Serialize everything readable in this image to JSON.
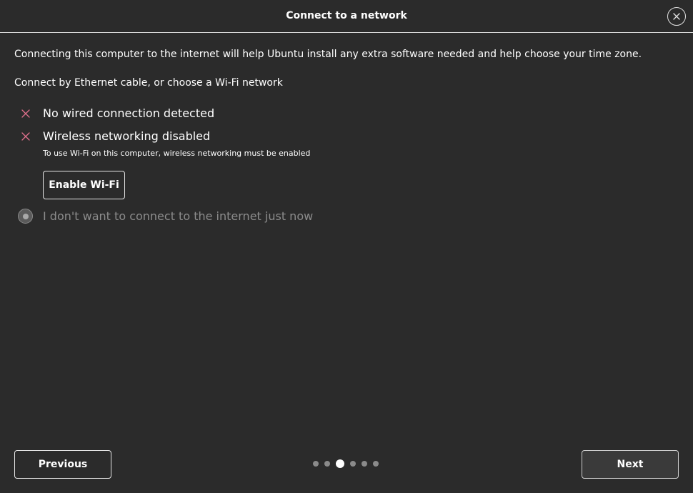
{
  "header": {
    "title": "Connect to a network",
    "close_icon": "close-icon"
  },
  "main": {
    "intro": "Connecting this computer to the internet will help Ubuntu install any extra software needed and help choose your time zone.",
    "choose_text": "Connect by Ethernet cable, or choose a Wi-Fi network",
    "status": [
      {
        "icon": "cross-icon",
        "label": "No wired connection detected"
      },
      {
        "icon": "cross-icon",
        "label": "Wireless networking disabled"
      }
    ],
    "wifi_hint": "To use Wi-Fi on this computer, wireless networking must be enabled",
    "enable_wifi_label": "Enable Wi-Fi",
    "no_connect_option": {
      "label": "I don't want to connect to the internet just now",
      "selected": true
    }
  },
  "footer": {
    "previous_label": "Previous",
    "next_label": "Next",
    "page_dots": {
      "total": 6,
      "current": 3
    }
  },
  "colors": {
    "background": "#2b2b2b",
    "cross_icon": "#e0708c",
    "text": "#ffffff",
    "muted_text": "#8c8c8c"
  }
}
